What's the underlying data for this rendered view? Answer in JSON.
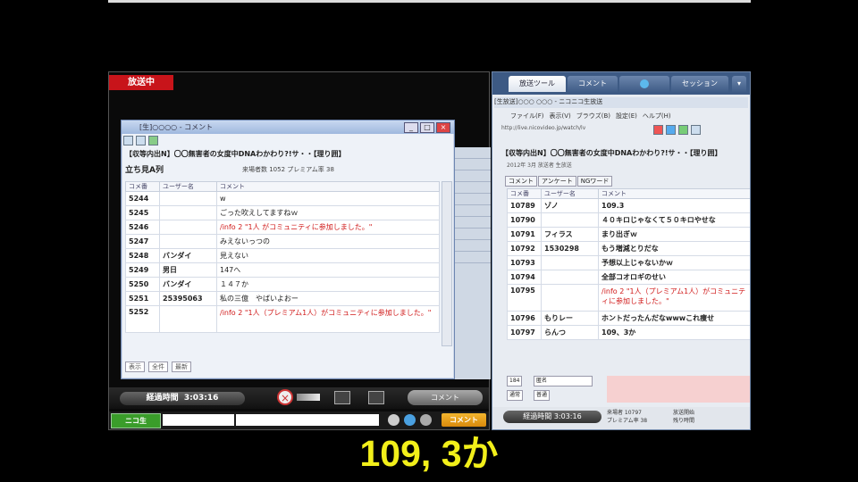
{
  "left_window": {
    "onair_label": "放送中",
    "comment_window": {
      "title": "[生]○○○○ - コメント",
      "header": "【収等内出N】〇〇無害者の女度中DNAわかわり?!サ・・【理り囲】",
      "stream_name": "立ち見A列",
      "stats": "来場者数 1052   プレミアム率 38",
      "columns": [
        "コメ番",
        "ユーザー名",
        "コメント"
      ],
      "rows": [
        {
          "num": "5244",
          "user": "",
          "comment": "w",
          "system": false
        },
        {
          "num": "5245",
          "user": "",
          "comment": "ごった吹えしてますねｗ",
          "system": false
        },
        {
          "num": "5246",
          "user": "",
          "comment": "/info 2 \"1人 がコミュニティに参加しました。\"",
          "system": true
        },
        {
          "num": "5247",
          "user": "",
          "comment": "みえないっつの",
          "system": false
        },
        {
          "num": "5248",
          "user": "バンダイ",
          "comment": "見えない",
          "system": false
        },
        {
          "num": "5249",
          "user": "男日",
          "comment": "147へ",
          "system": false
        },
        {
          "num": "5250",
          "user": "バンダイ",
          "comment": "１４７か",
          "system": false
        },
        {
          "num": "5251",
          "user": "25395063",
          "comment": "私の三億　やばいよおー",
          "system": false
        },
        {
          "num": "5252",
          "user": "",
          "comment": "/info 2 \"1人（プレミアム1人）がコミュニティに参加しました。\"",
          "system": true
        }
      ],
      "footer": {
        "a": "表示",
        "b": "全件",
        "c": "最新"
      }
    },
    "controls": {
      "elapsed_label": "経過時間",
      "elapsed_time": "3:03:16",
      "comment_button": "コメント"
    },
    "inputbar": {
      "logo": "ニコ生",
      "submit_label": "コメント"
    }
  },
  "right_panel": {
    "tabs": [
      "放送ツール",
      "コメント",
      "",
      "セッション"
    ],
    "browser_title": "[生放送]○○○ ○○○ - ニコニコ生放送",
    "menu": [
      "ファイル(F)",
      "表示(V)",
      "ブラウズ(B)",
      "設定(E)",
      "ヘルプ(H)"
    ],
    "address": "http://live.nicovideo.jp/watch/lv",
    "header": "【収等内出N】〇〇無害者の女度中DNAわかわり?!サ・・【理り囲】",
    "meta": "2012年 3月  放送者  生放送",
    "subtabs": [
      "コメント",
      "アンケート",
      "NGワード"
    ],
    "columns": [
      "コメ番",
      "ユーザー名",
      "コメント"
    ],
    "rows": [
      {
        "num": "10789",
        "user": "ゾノ",
        "comment": "109.3",
        "system": false
      },
      {
        "num": "10790",
        "user": "",
        "comment": "４０キロじゃなくて５０キロやせな",
        "system": false
      },
      {
        "num": "10791",
        "user": "フィラス",
        "comment": "まり出ぎｗ",
        "system": false
      },
      {
        "num": "10792",
        "user": "1530298",
        "comment": "もう増減とりだな",
        "system": false
      },
      {
        "num": "10793",
        "user": "",
        "comment": "予想以上じゃないかｗ",
        "system": false
      },
      {
        "num": "10794",
        "user": "",
        "comment": "全部コオロギのせい",
        "system": false
      },
      {
        "num": "10795",
        "user": "",
        "comment": "/info 2 \"1人（プレミアム1人）がコミュニティに参加しました。\"",
        "system": true
      },
      {
        "num": "10796",
        "user": "もりレー",
        "comment": "ホントだったんだなwwwこれ痩せ",
        "system": false
      },
      {
        "num": "10797",
        "user": "らんつ",
        "comment": "109、3か",
        "system": false
      }
    ],
    "bottom": {
      "sel1": "184",
      "sel2": "匿名",
      "sel3": "通常",
      "sel4": "普通"
    },
    "status": {
      "elapsed": "経過時間 3:03:16",
      "a1": "来場者 10797",
      "a2": "プレミアム率 38",
      "b1": "放送開始",
      "b2": "残り時間"
    }
  },
  "subtitle": "109, 3か"
}
